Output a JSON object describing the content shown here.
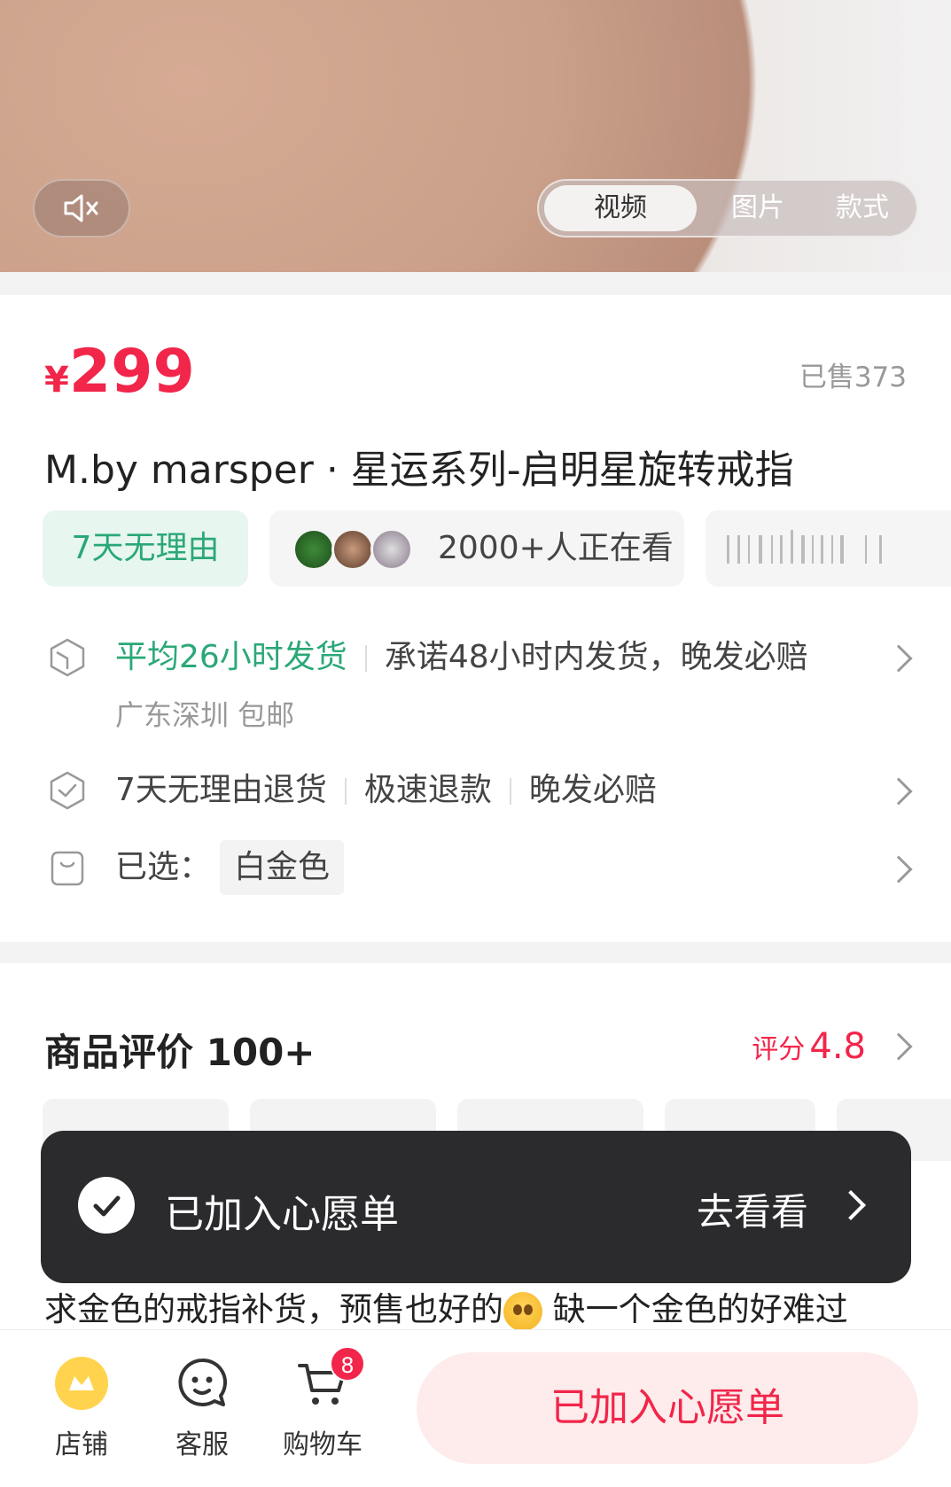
{
  "media": {
    "tabs": [
      "视频",
      "图片",
      "款式"
    ],
    "active_tab": "视频",
    "mute_icon": "speaker-muted-icon"
  },
  "product": {
    "currency": "¥",
    "price": "299",
    "sold": "已售373",
    "title": "M.by marsper · 星运系列-启明星旋转戒指",
    "return_tag": "7天无理由",
    "viewers": "2000+人正在看"
  },
  "service": {
    "shipping_avg": "平均26小时发货",
    "shipping_promise": "承诺48小时内发货，晚发必赔",
    "origin": "广东深圳 包邮",
    "return_items": [
      "7天无理由退货",
      "极速退款",
      "晚发必赔"
    ],
    "selected_label": "已选：",
    "selected_value": "白金色"
  },
  "reviews": {
    "title": "商品评价 100+",
    "score_label": "评分",
    "score": "4.8",
    "preview_text_1": "求金色的戒指补货，预售也好的",
    "preview_text_2": " 缺一个金色的好难过"
  },
  "toast": {
    "message": "已加入心愿单",
    "link": "去看看"
  },
  "bottom_bar": {
    "store": "店铺",
    "service": "客服",
    "cart": "购物车",
    "cart_count": "8",
    "cta": "已加入心愿单"
  },
  "colors": {
    "accent": "#f2254a",
    "green": "#2aa877",
    "toast_bg": "#2b2b2d"
  }
}
